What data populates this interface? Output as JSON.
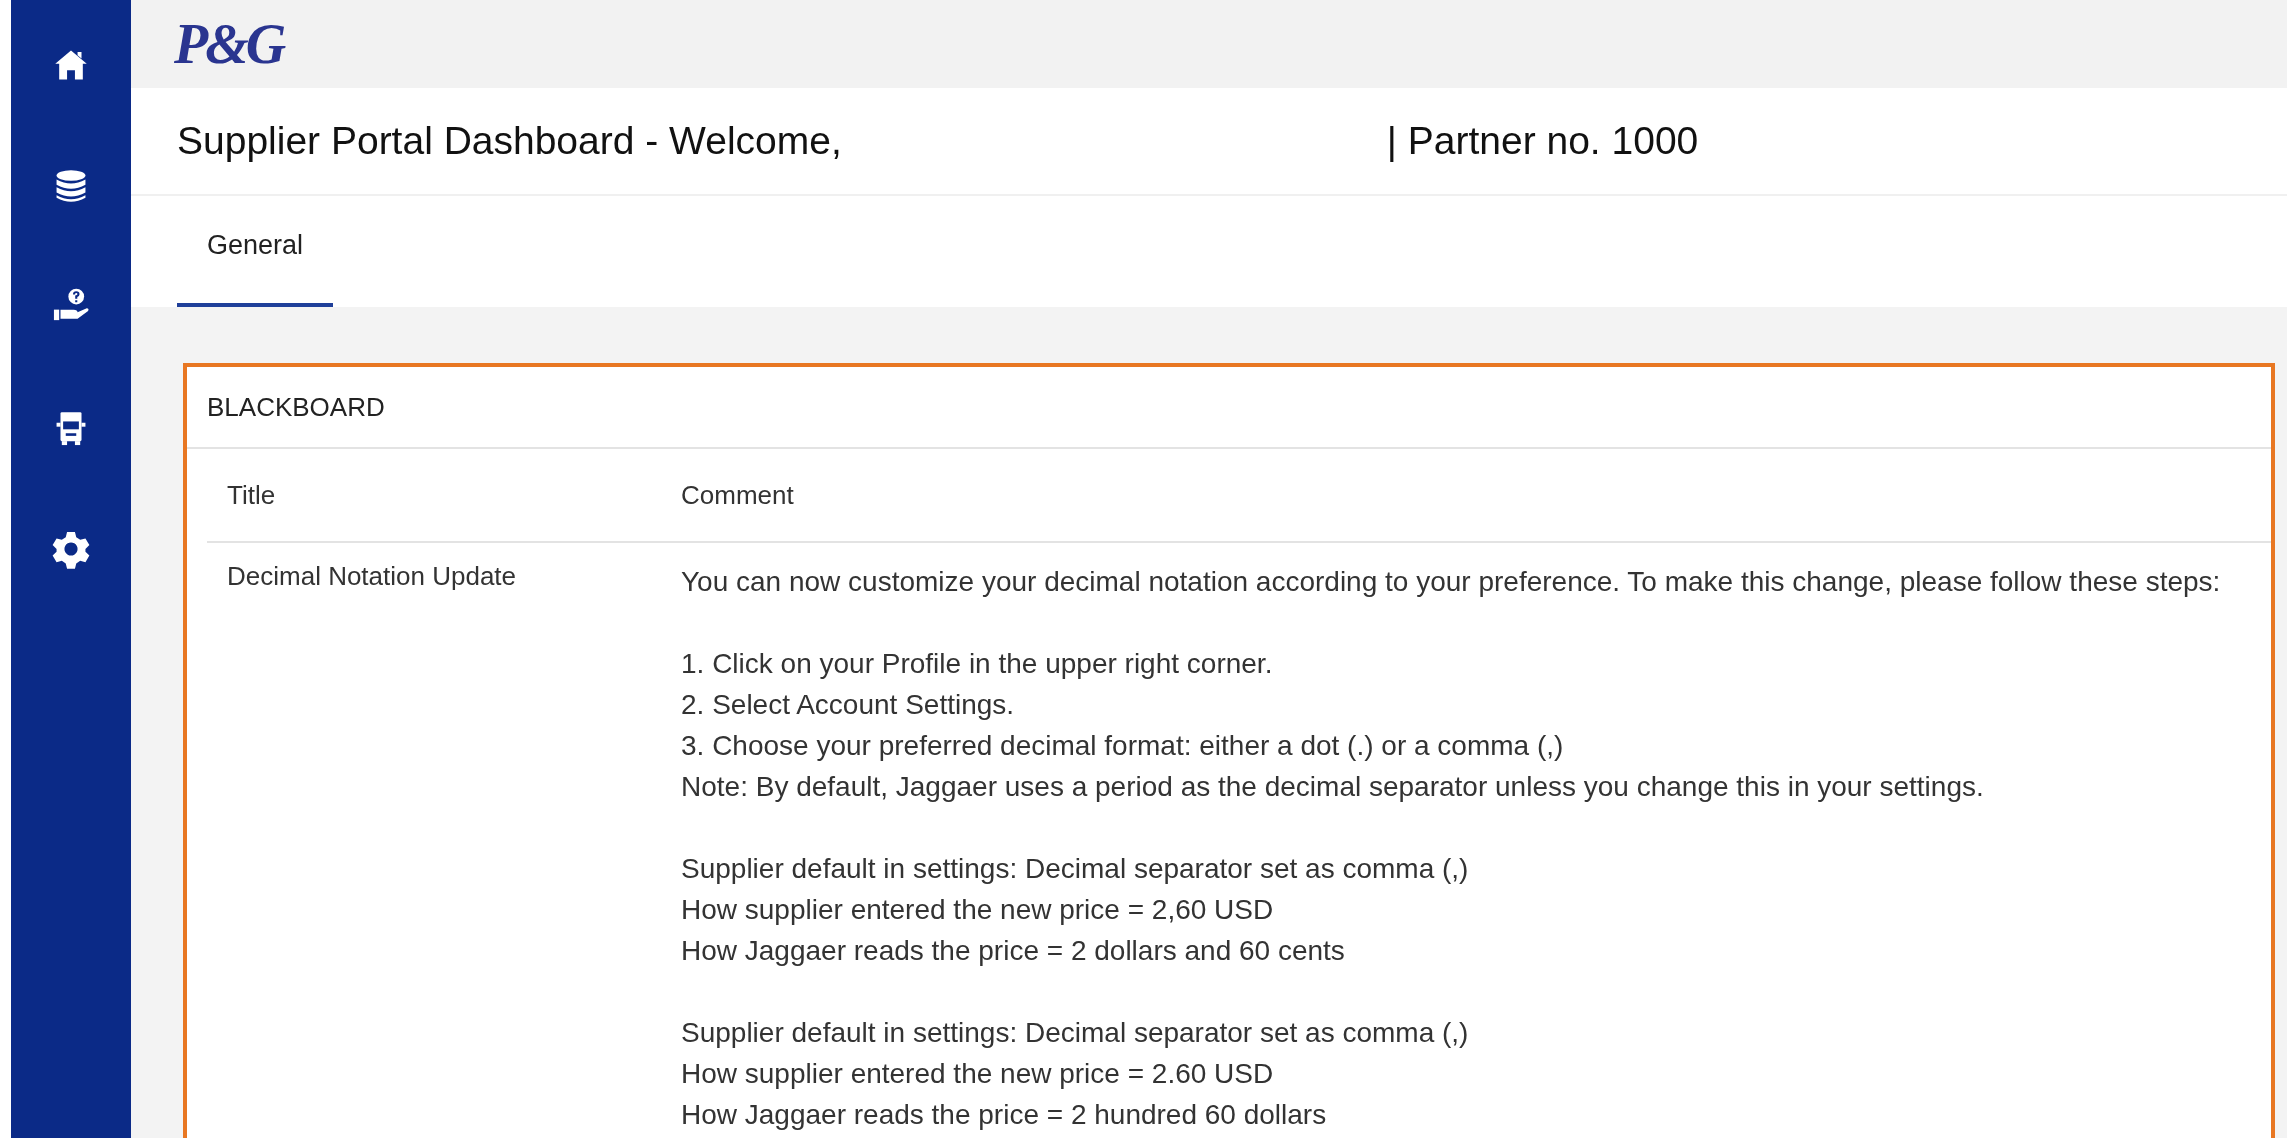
{
  "logo": "P&G",
  "header": {
    "title": "Supplier Portal Dashboard - Welcome,",
    "partner": "| Partner no. 1000"
  },
  "tabs": [
    {
      "label": "General",
      "selected": true
    }
  ],
  "blackboard": {
    "title": "BLACKBOARD",
    "columns": [
      "Title",
      "Comment"
    ],
    "rows": [
      {
        "title": "Decimal Notation Update",
        "comment": [
          [
            "You can now customize your decimal notation according to your preference. To make this change, please follow these steps:"
          ],
          [
            "1. Click on your Profile in the upper right corner.",
            "2. Select Account Settings.",
            "3. Choose your preferred decimal format: either a dot (.) or a comma (,)",
            "Note: By default, Jaggaer uses a period as the decimal separator unless you change this in your settings."
          ],
          [
            "Supplier default in settings: Decimal separator set as comma (,)",
            "How supplier entered the new price = 2,60 USD",
            "How Jaggaer reads the price = 2 dollars and 60 cents"
          ],
          [
            "Supplier default in settings: Decimal separator set as comma (,)",
            "How supplier entered the new price = 2.60 USD",
            "How Jaggaer reads the price = 2 hundred 60 dollars"
          ]
        ]
      }
    ]
  }
}
